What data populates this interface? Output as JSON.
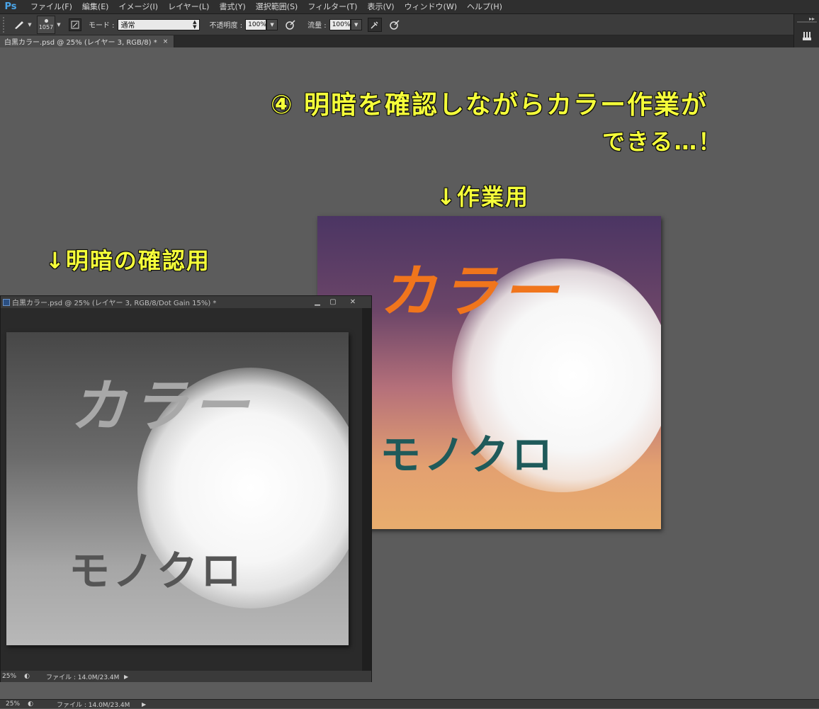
{
  "app": {
    "logo": "Ps"
  },
  "menu": [
    "ファイル(F)",
    "編集(E)",
    "イメージ(I)",
    "レイヤー(L)",
    "書式(Y)",
    "選択範囲(S)",
    "フィルター(T)",
    "表示(V)",
    "ウィンドウ(W)",
    "ヘルプ(H)"
  ],
  "options": {
    "brush_size": "1057",
    "mode_label": "モード :",
    "mode_value": "通常",
    "opacity_label": "不透明度 :",
    "opacity_value": "100%",
    "flow_label": "流量 :",
    "flow_value": "100%"
  },
  "document_tab": {
    "title": "白黒カラー.psd @ 25% (レイヤー 3, RGB/8) *",
    "close": "×"
  },
  "annotations": {
    "headline_line1": "④ 明暗を確認しながらカラー作業が",
    "headline_line2": "できる…！",
    "work_label": "↓作業用",
    "check_label": "↓明暗の確認用"
  },
  "artwork": {
    "color": {
      "karaa": "カラー",
      "mono": "モノクロ"
    },
    "grayscale": {
      "karaa": "カラー",
      "mono": "モノクロ"
    }
  },
  "mono_window": {
    "title": "白黒カラー.psd @ 25% (レイヤー 3, RGB/8/Dot Gain 15%) *",
    "zoom": "25%",
    "file_info": "ファイル : 14.0M/23.4M"
  },
  "status": {
    "zoom": "25%",
    "file_info": "ファイル : 14.0M/23.4M"
  },
  "colors": {
    "annotation": "#f5ff3a",
    "color_text_karaa": "#f0751c",
    "color_text_mono": "#1f5a5a"
  }
}
